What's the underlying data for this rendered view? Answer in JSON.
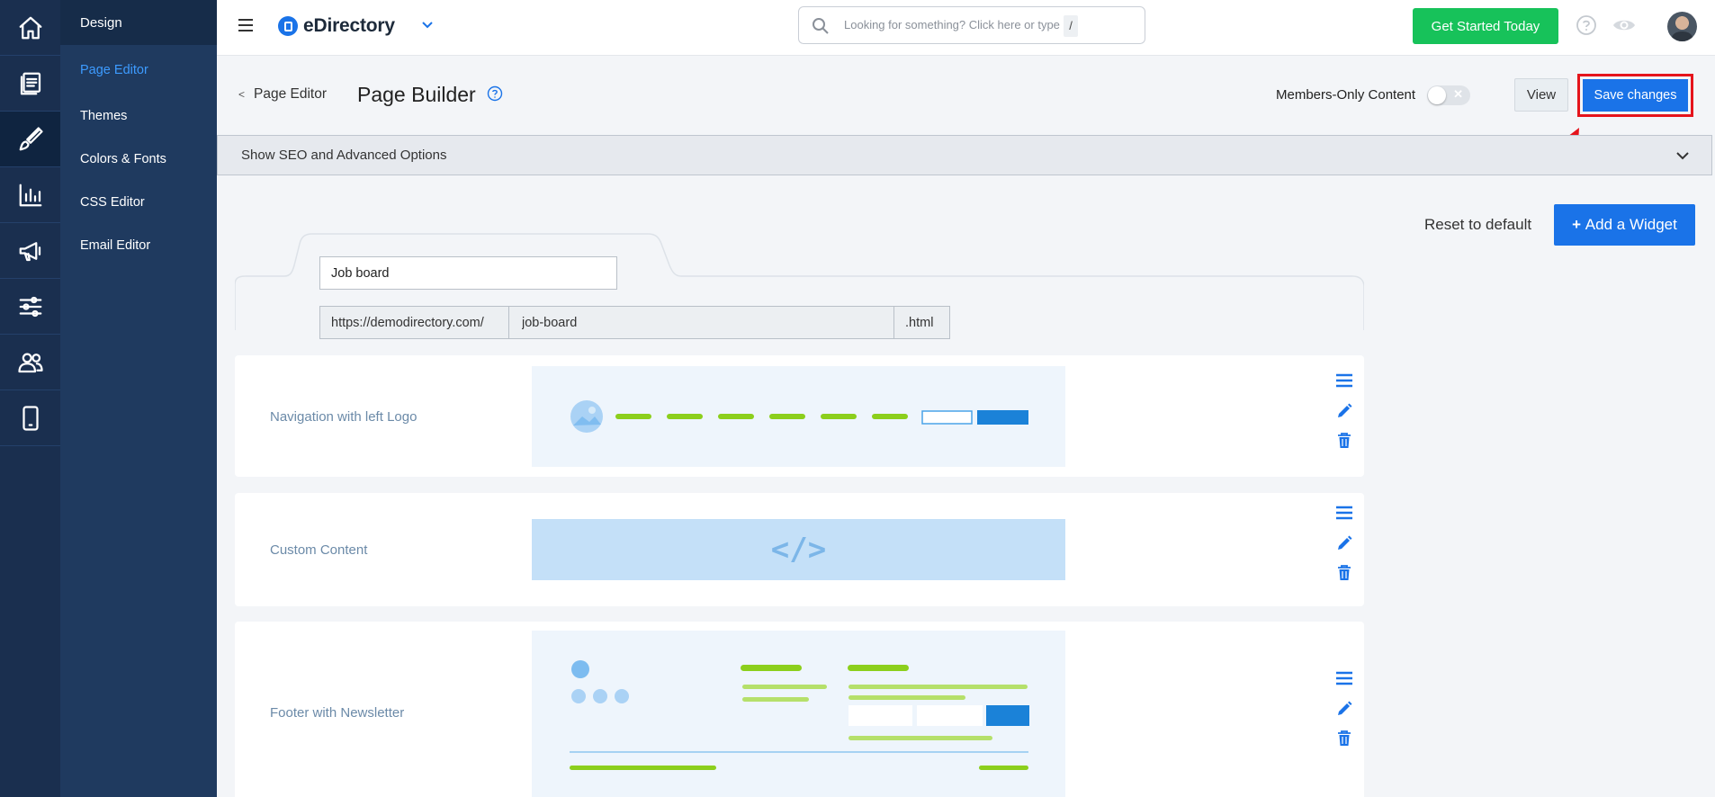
{
  "sidebar": {
    "section_title": "Design",
    "items": [
      {
        "label": "Page Editor",
        "active": true
      },
      {
        "label": "Themes"
      },
      {
        "label": "Colors & Fonts"
      },
      {
        "label": "CSS Editor"
      },
      {
        "label": "Email Editor"
      }
    ],
    "rail_icons": [
      "home-icon",
      "pages-icon",
      "brush-icon",
      "chart-icon",
      "megaphone-icon",
      "sliders-icon",
      "users-icon",
      "mobile-icon"
    ]
  },
  "topbar": {
    "brand": "eDirectory",
    "search_placeholder": "Looking for something? Click here or type",
    "search_shortcut": "/",
    "cta_label": "Get Started Today"
  },
  "header": {
    "back_label": "Page Editor",
    "title": "Page Builder",
    "members_only_label": "Members-Only Content",
    "members_only_enabled": false,
    "view_label": "View",
    "save_label": "Save changes"
  },
  "seo": {
    "label": "Show SEO and Advanced Options"
  },
  "actions": {
    "reset_label": "Reset to default",
    "add_widget_label": "Add a Widget"
  },
  "page": {
    "name": "Job board",
    "url_prefix": "https://demodirectory.com/",
    "url_slug": "job-board",
    "url_suffix": ".html"
  },
  "widgets": [
    {
      "name": "Navigation with left Logo",
      "preview": "navigation"
    },
    {
      "name": "Custom Content",
      "preview": "code",
      "code_glyph": "</>"
    },
    {
      "name": "Footer with Newsletter",
      "preview": "footer"
    }
  ],
  "colors": {
    "accent": "#1a73e8",
    "cta": "#17c25a",
    "highlight": "#e5141c",
    "sidebar": "#1f3a5f"
  }
}
